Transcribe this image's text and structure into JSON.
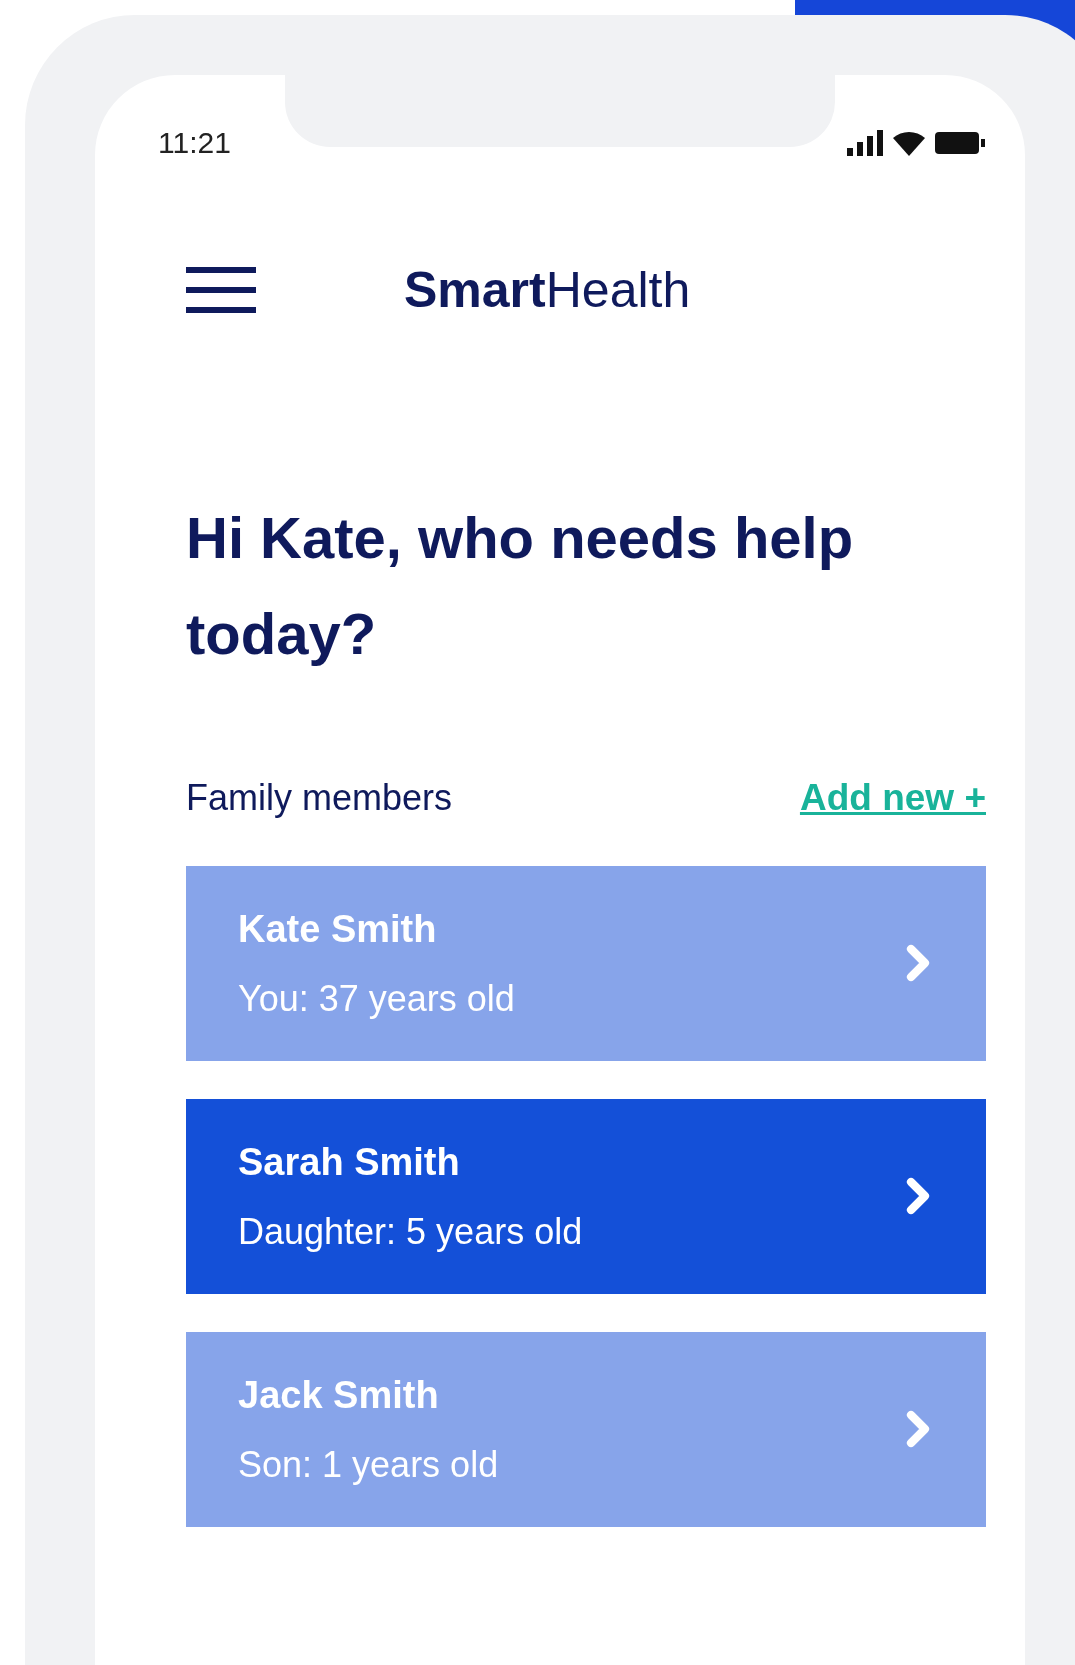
{
  "status_bar": {
    "time": "11:21"
  },
  "header": {
    "brand_bold": "Smart",
    "brand_light": "Health"
  },
  "greeting": "Hi Kate, who needs help today?",
  "section": {
    "title": "Family members",
    "action": "Add new +"
  },
  "members": [
    {
      "name": "Kate Smith",
      "detail": "You: 37 years old",
      "selected": false
    },
    {
      "name": "Sarah Smith",
      "detail": "Daughter: 5 years old",
      "selected": true
    },
    {
      "name": "Jack Smith",
      "detail": "Son: 1 years old",
      "selected": false
    }
  ]
}
